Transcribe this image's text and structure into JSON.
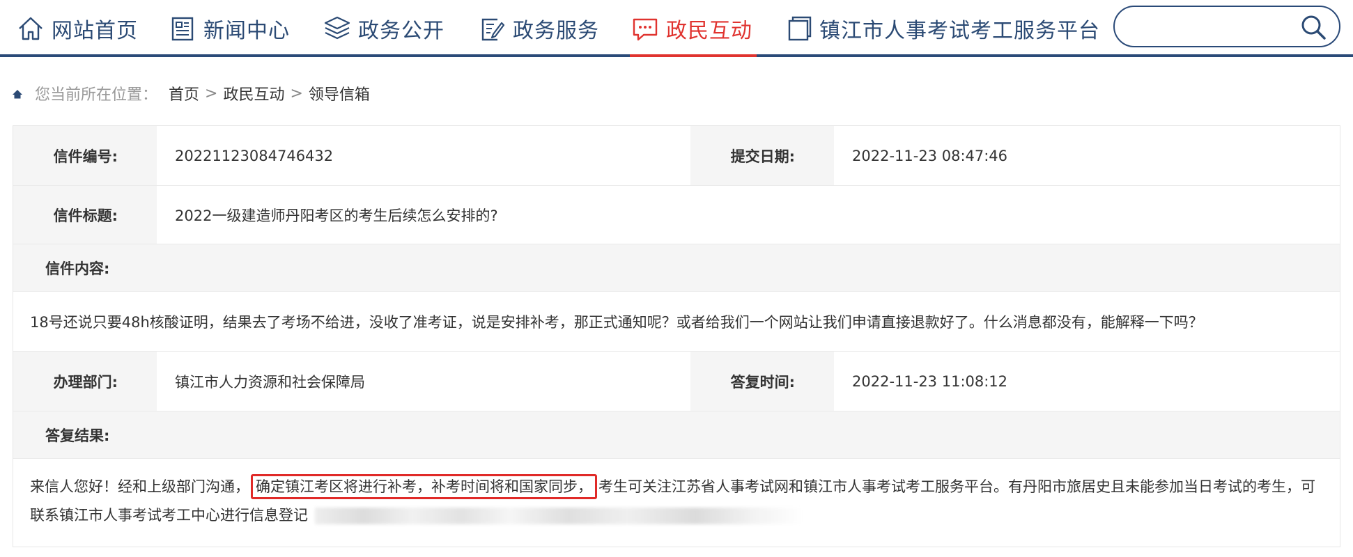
{
  "nav": {
    "items": [
      {
        "label": "网站首页",
        "icon": "home-icon"
      },
      {
        "label": "新闻中心",
        "icon": "newspaper-icon"
      },
      {
        "label": "政务公开",
        "icon": "layers-icon"
      },
      {
        "label": "政务服务",
        "icon": "document-pen-icon"
      },
      {
        "label": "政民互动",
        "icon": "chat-icon",
        "active": true
      },
      {
        "label": "镇江市人事考试考工服务平台",
        "icon": "square-icon"
      }
    ],
    "search": {
      "placeholder": "",
      "icon": "search-icon"
    },
    "colors": {
      "primary": "#2a4a78",
      "active": "#e0332f"
    }
  },
  "breadcrumb": {
    "prefix": "您当前所在位置：",
    "items": [
      "首页",
      "政民互动",
      "领导信箱"
    ],
    "separator": ">"
  },
  "letter": {
    "number_label": "信件编号:",
    "number": "20221123084746432",
    "submit_date_label": "提交日期:",
    "submit_date": "2022-11-23 08:47:46",
    "title_label": "信件标题:",
    "title": "2022一级建造师丹阳考区的考生后续怎么安排的?",
    "content_label": "信件内容:",
    "content": "18号还说只要48h核酸证明，结果去了考场不给进，没收了准考证，说是安排补考，那正式通知呢？或者给我们一个网站让我们申请直接退款好了。什么消息都没有，能解释一下吗？",
    "dept_label": "办理部门:",
    "dept": "镇江市人力资源和社会保障局",
    "reply_time_label": "答复时间:",
    "reply_time": "2022-11-23 11:08:12",
    "result_label": "答复结果:",
    "reply": {
      "before": "来信人您好！经和上级部门沟通，",
      "highlight": "确定镇江考区将进行补考，补考时间将和国家同步，",
      "after": "考生可关注江苏省人事考试网和镇江市人事考试考工服务平台。有丹阳市旅居史且未能参加当日考试的考生，可联系镇江市人事考试考工中心进行信息登记"
    },
    "highlight_color": "#e02a28"
  }
}
